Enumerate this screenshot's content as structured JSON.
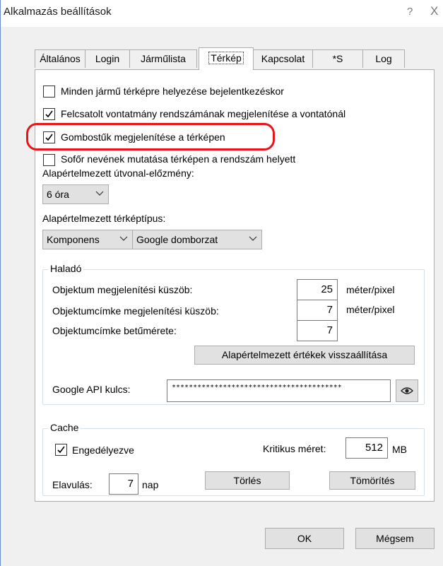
{
  "window": {
    "title": "Alkalmazás beállítások",
    "help_glyph": "?",
    "close_glyph": "X"
  },
  "tabs": [
    {
      "label": "Általános"
    },
    {
      "label": "Login"
    },
    {
      "label": "Járműlista"
    },
    {
      "label": "Térkép",
      "active": true
    },
    {
      "label": "Kapcsolat"
    },
    {
      "label": "*S"
    },
    {
      "label": "Log"
    }
  ],
  "options": {
    "place_all_vehicles": {
      "label": "Minden jármű térképre helyezése bejelentkezéskor",
      "checked": false
    },
    "show_trailer_plate": {
      "label": "Felcsatolt vontatmány rendszámának megjelenítése a vontatónál",
      "checked": true
    },
    "show_pins": {
      "label": "Gombostűk megjelenítése a térképen",
      "checked": true
    },
    "show_driver_name": {
      "label": "Sofőr nevének mutatása térképen a rendszám helyett",
      "checked": false
    }
  },
  "route_history": {
    "label": "Alapértelmezett útvonal-előzmény:",
    "selected": "6 óra"
  },
  "map_type": {
    "label": "Alapértelmezett térképtípus:",
    "provider_selected": "Komponens",
    "layer_selected": "Google domborzat"
  },
  "advanced": {
    "title": "Haladó",
    "object_threshold": {
      "label": "Objektum megjelenítési küszöb:",
      "value": "25",
      "unit": "méter/pixel"
    },
    "label_threshold": {
      "label": "Objektumcímke megjelenítési küszöb:",
      "value": "7",
      "unit": "méter/pixel"
    },
    "label_font_size": {
      "label": "Objektumcímke betűmérete:",
      "value": "7"
    },
    "reset_button": "Alapértelmezett értékek visszaállítása",
    "api_key": {
      "label": "Google API kulcs:",
      "value": "****************************************"
    }
  },
  "cache": {
    "title": "Cache",
    "enabled": {
      "label": "Engedélyezve",
      "checked": true
    },
    "critical_size": {
      "label": "Kritikus méret:",
      "value": "512",
      "unit": "MB"
    },
    "expiry": {
      "label": "Elavulás:",
      "value": "7",
      "unit": "nap"
    },
    "delete_button": "Törlés",
    "compress_button": "Tömörítés"
  },
  "footer": {
    "ok_button": "OK",
    "cancel_button": "Mégsem"
  },
  "colors": {
    "highlight": "#e8141a",
    "panel_bg": "#ffffff",
    "window_bg": "#f0f0f0"
  }
}
